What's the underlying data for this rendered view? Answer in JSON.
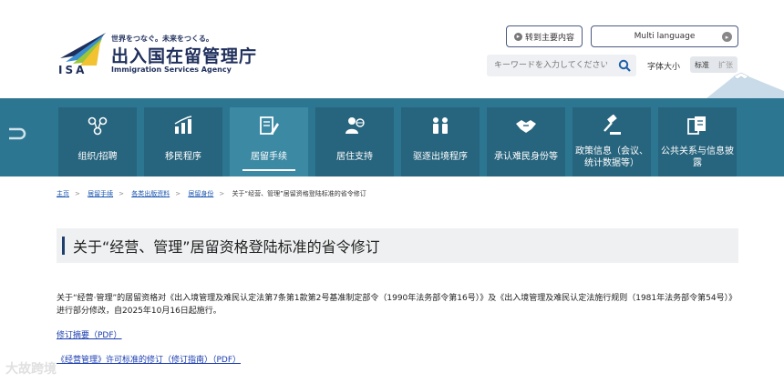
{
  "header": {
    "tagline": "世界をつなぐ。未来をつくる。",
    "agency_jp": "出入国在留管理庁",
    "agency_en": "Immigration Services Agency",
    "logo_abbr": "ISA",
    "skip_label": "转到主要内容",
    "language_label": "Multi language",
    "search_placeholder": "キーワードを入力してください",
    "font_size_label": "字体大小",
    "font_standard": "标准",
    "font_large": "扩张"
  },
  "nav": {
    "items": [
      {
        "label": "组织/招聘",
        "icon": "organization-icon"
      },
      {
        "label": "移民程序",
        "icon": "chart-icon"
      },
      {
        "label": "居留手续",
        "icon": "document-edit-icon"
      },
      {
        "label": "居住支持",
        "icon": "person-globe-icon"
      },
      {
        "label": "驱逐出境程序",
        "icon": "people-icon"
      },
      {
        "label": "承认难民身份等",
        "icon": "handshake-icon"
      },
      {
        "label": "政策信息（会议、统计数据等）",
        "icon": "gavel-icon"
      },
      {
        "label": "公共关系与信息披露",
        "icon": "documents-icon"
      }
    ]
  },
  "breadcrumb": {
    "items": [
      "主页",
      "居留手续",
      "各类出版资料",
      "居留身份"
    ],
    "current": "关于“经营、管理”居留资格登陆标准的省令修订"
  },
  "page": {
    "title": "关于“经营、管理”居留资格登陆标准的省令修订",
    "paragraph": "关于“经营·管理”的居留资格对《出入境管理及难民认定法第7条第1款第2号基准制定部令（1990年法务部令第16号）》及《出入境管理及难民认定法施行规则（1981年法务部令第54号）》进行部分修改，自2025年10月16日起施行。",
    "link1": "修订摘要（PDF）",
    "link2": "《经营管理》许可标准的修订（修订指南）（PDF）",
    "watermark": "大故跨境"
  },
  "colors": {
    "nav_band": "#2d7691",
    "nav_item": "#27647d",
    "nav_active": "#3c89a4",
    "brand_navy": "#1f2f5c",
    "link": "#1a3cb0"
  }
}
